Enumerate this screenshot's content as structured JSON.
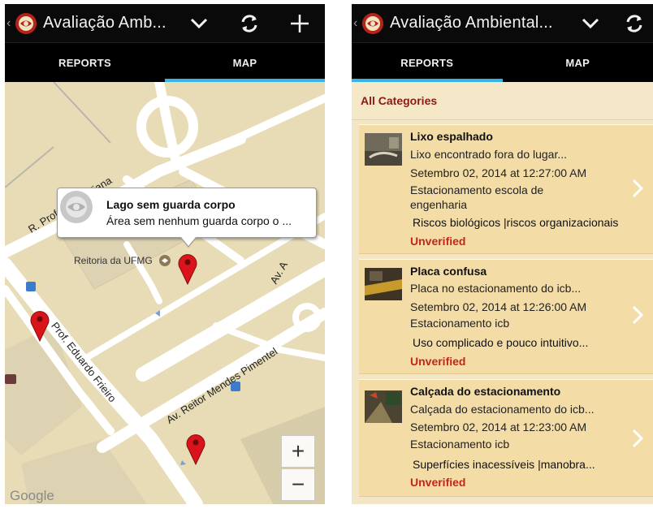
{
  "left_screen": {
    "actionbar": {
      "title": "Avaliação Amb...",
      "icons": [
        "app-logo",
        "chevron-down-icon",
        "refresh-icon",
        "add-icon"
      ]
    },
    "tabs": [
      {
        "label": "REPORTS",
        "selected": false
      },
      {
        "label": "MAP",
        "selected": true
      }
    ],
    "map": {
      "road_labels": [
        "R. Prof. Baeta Viana",
        "Av. A",
        "Prof. Eduardo Frieiro",
        "Av. Reitor Mendes Pimentel"
      ],
      "poi_label": "Reitoria da UFMG",
      "callout": {
        "title": "Lago sem guarda corpo",
        "description": "Área sem nenhum guarda corpo o ..."
      },
      "zoom_in": "+",
      "zoom_out": "−",
      "attribution": "Google"
    }
  },
  "right_screen": {
    "actionbar": {
      "title": "Avaliação Ambiental...",
      "icons": [
        "app-logo",
        "chevron-down-icon",
        "refresh-icon"
      ]
    },
    "tabs": [
      {
        "label": "REPORTS",
        "selected": true
      },
      {
        "label": "MAP",
        "selected": false
      }
    ],
    "category_header": "All Categories",
    "reports": [
      {
        "title": "Lixo espalhado",
        "description": "Lixo encontrado fora do lugar...",
        "date": "Setembro 02, 2014 at 12:27:00 AM",
        "location": "Estacionamento escola de engenharia",
        "categories": "Riscos biológicos |riscos organizacionais",
        "status": "Unverified"
      },
      {
        "title": "Placa confusa",
        "description": "Placa no estacionamento do icb...",
        "date": "Setembro 02, 2014 at 12:26:00 AM",
        "location": "Estacionamento icb",
        "categories": "Uso complicado e pouco intuitivo...",
        "status": "Unverified"
      },
      {
        "title": "Calçada do estacionamento",
        "description": "Calçada do estacionamento do icb...",
        "date": "Setembro 02, 2014 at 12:23:00 AM",
        "location": "Estacionamento icb",
        "categories": "Superfícies inacessíveis |manobra...",
        "status": "Unverified"
      }
    ]
  },
  "colors": {
    "accent": "#33b5e5",
    "status_unverified": "#c0281a",
    "category_header": "#8b1a12",
    "marker": "#d9141b"
  }
}
